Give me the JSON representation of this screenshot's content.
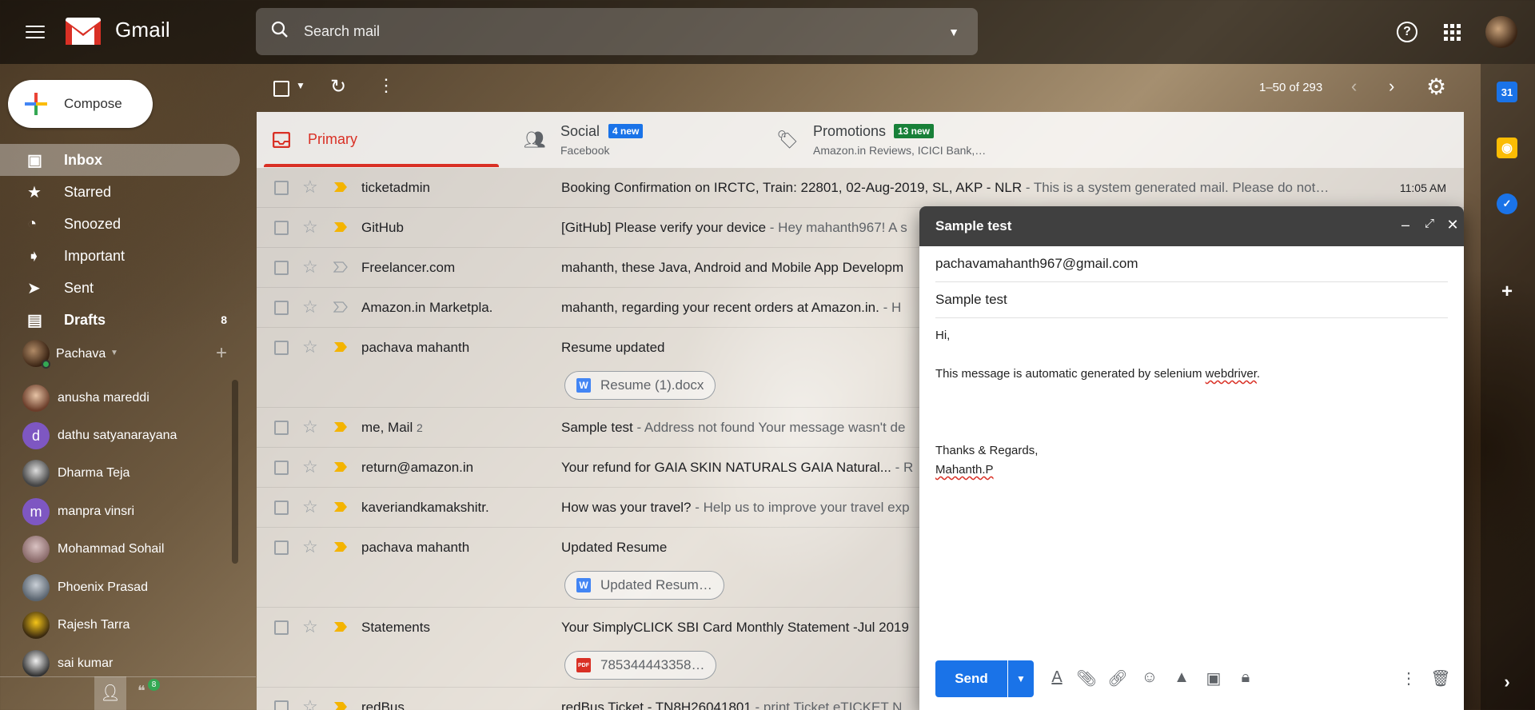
{
  "app": {
    "name": "Gmail"
  },
  "search": {
    "placeholder": "Search mail"
  },
  "compose_button": {
    "label": "Compose"
  },
  "sidebar": {
    "items": [
      {
        "label": "Inbox",
        "count": ""
      },
      {
        "label": "Starred",
        "count": ""
      },
      {
        "label": "Snoozed",
        "count": ""
      },
      {
        "label": "Important",
        "count": ""
      },
      {
        "label": "Sent",
        "count": ""
      },
      {
        "label": "Drafts",
        "count": "8"
      }
    ]
  },
  "chat": {
    "user": "Pachava",
    "contacts": [
      {
        "name": "anusha mareddi",
        "initial": ""
      },
      {
        "name": "dathu satyanarayana",
        "initial": "d"
      },
      {
        "name": "Dharma Teja",
        "initial": ""
      },
      {
        "name": "manpra vinsri",
        "initial": "m"
      },
      {
        "name": "Mohammad Sohail",
        "initial": ""
      },
      {
        "name": "Phoenix Prasad",
        "initial": ""
      },
      {
        "name": "Rajesh Tarra",
        "initial": ""
      },
      {
        "name": "sai kumar",
        "initial": ""
      }
    ],
    "hangouts_badge": "8"
  },
  "toolbar": {
    "pager": "1–50 of 293"
  },
  "tabs": [
    {
      "name": "Primary",
      "badge": "",
      "sub": ""
    },
    {
      "name": "Social",
      "badge": "4 new",
      "sub": "Facebook"
    },
    {
      "name": "Promotions",
      "badge": "13 new",
      "sub": "Amazon.in Reviews, ICICI Bank,…"
    }
  ],
  "emails": [
    {
      "sender": "ticketadmin",
      "count": "",
      "subject": "Booking Confirmation on IRCTC, Train: 22801, 02-Aug-2019, SL, AKP - NLR",
      "snippet": " - This is a system generated mail. Please do not…",
      "time": "11:05 AM",
      "important": true,
      "attachment": ""
    },
    {
      "sender": "GitHub",
      "count": "",
      "subject": "[GitHub] Please verify your device",
      "snippet": " - Hey mahanth967! A s",
      "time": "",
      "important": true,
      "attachment": ""
    },
    {
      "sender": "Freelancer.com",
      "count": "",
      "subject": "mahanth, these Java, Android and Mobile App Developm",
      "snippet": "",
      "time": "",
      "important": false,
      "attachment": ""
    },
    {
      "sender": "Amazon.in Marketpla.",
      "count": "",
      "subject": "mahanth, regarding your recent orders at Amazon.in.",
      "snippet": " - H",
      "time": "",
      "important": false,
      "attachment": ""
    },
    {
      "sender": "pachava mahanth",
      "count": "",
      "subject": "Resume updated",
      "snippet": "",
      "time": "",
      "important": true,
      "attachment": "Resume (1).docx",
      "attachment_type": "W"
    },
    {
      "sender": "me, Mail",
      "count": "2",
      "subject": "Sample test",
      "snippet": " - Address not found Your message wasn't de",
      "time": "",
      "important": true,
      "attachment": ""
    },
    {
      "sender": "return@amazon.in",
      "count": "",
      "subject": "Your refund for GAIA SKIN NATURALS GAIA Natural...",
      "snippet": " - R",
      "time": "",
      "important": true,
      "attachment": ""
    },
    {
      "sender": "kaveriandkamakshitr.",
      "count": "",
      "subject": "How was your travel?",
      "snippet": " - Help us to improve your travel exp",
      "time": "",
      "important": true,
      "attachment": ""
    },
    {
      "sender": "pachava mahanth",
      "count": "",
      "subject": "Updated Resume",
      "snippet": "",
      "time": "",
      "important": true,
      "attachment": "Updated Resum…",
      "attachment_type": "W"
    },
    {
      "sender": "Statements",
      "count": "",
      "subject": "Your SimplyCLICK SBI Card Monthly Statement -Jul 2019",
      "snippet": "",
      "time": "",
      "important": true,
      "attachment": "785344443358…",
      "attachment_type": "PDF"
    },
    {
      "sender": "redBus",
      "count": "",
      "subject": "redBus Ticket - TN8H26041801",
      "snippet": " - print Ticket eTICKET N",
      "time": "",
      "important": true,
      "attachment": ""
    }
  ],
  "compose_window": {
    "title": "Sample test",
    "to": "pachavamahanth967@gmail.com",
    "subject": "Sample test",
    "body_greeting": "Hi,",
    "body_line_prefix": "This message is automatic generated by selenium ",
    "body_line_misspelled": "webdriver",
    "body_line_suffix": ".",
    "signoff": "Thanks & Regards,",
    "signature": "Mahanth.P",
    "send_label": "Send"
  },
  "side_panel": {
    "calendar_label": "31"
  },
  "colors": {
    "accent_red": "#d93025",
    "send_blue": "#1a73e8",
    "social_badge": "#1a73e8",
    "promotions_badge": "#188038",
    "important_marker": "#f4b400"
  },
  "icons": [
    "menu-icon",
    "search-icon",
    "help-icon",
    "apps-icon",
    "refresh-icon",
    "settings-icon",
    "star-icon",
    "important-icon",
    "paperclip-icon",
    "link-icon",
    "emoji-icon",
    "drive-icon",
    "photo-icon",
    "trash-icon"
  ]
}
